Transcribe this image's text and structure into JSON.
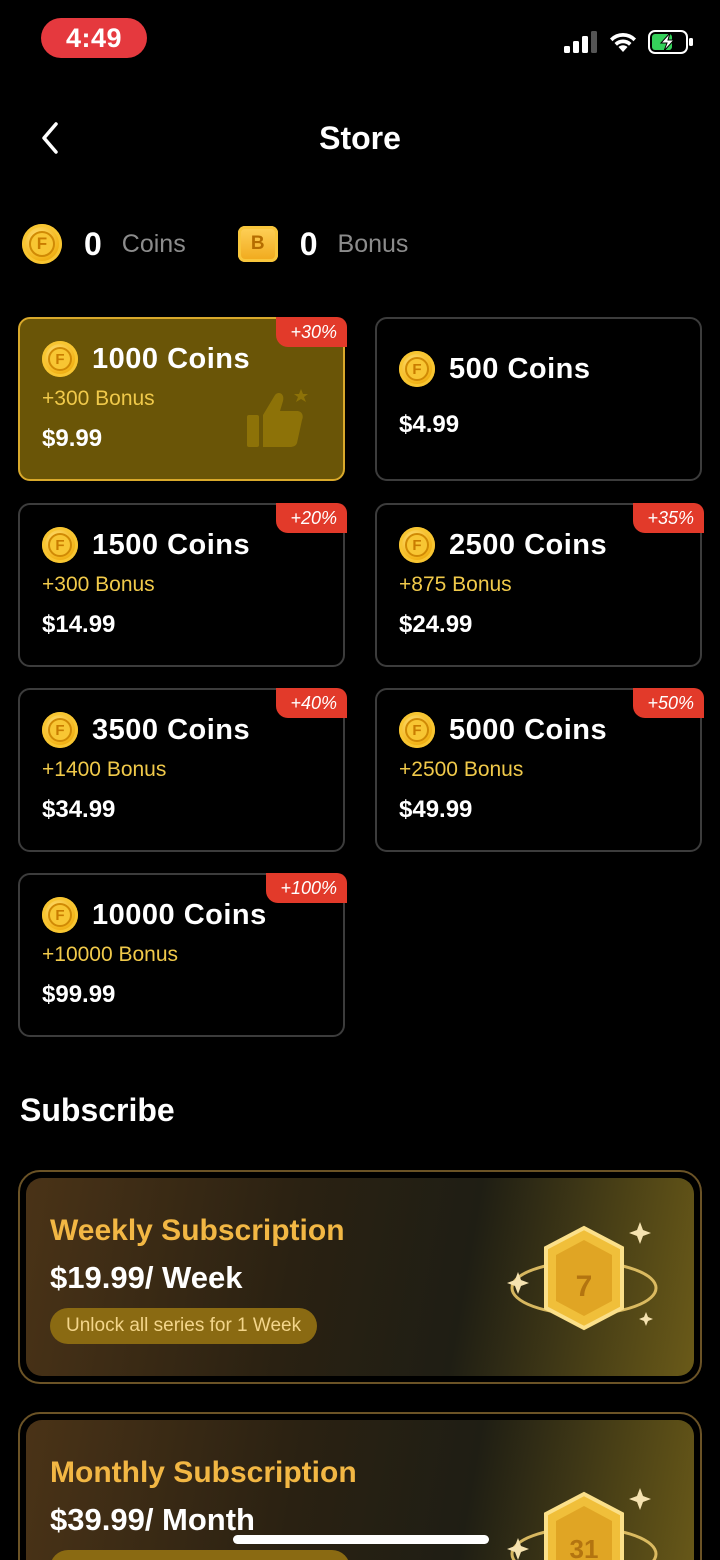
{
  "status_bar": {
    "time": "4:49"
  },
  "header": {
    "title": "Store"
  },
  "balance": {
    "coins_value": "0",
    "coins_label": "Coins",
    "bonus_value": "0",
    "bonus_label": "Bonus",
    "coin_icon_letter": "F",
    "bonus_icon_letter": "B"
  },
  "packages": [
    {
      "coins": "1000",
      "unit": "Coins",
      "bonus": "+300 Bonus",
      "price": "$9.99",
      "badge": "+30%",
      "selected": true
    },
    {
      "coins": "500",
      "unit": "Coins",
      "bonus": "",
      "price": "$4.99",
      "badge": ""
    },
    {
      "coins": "1500",
      "unit": "Coins",
      "bonus": "+300 Bonus",
      "price": "$14.99",
      "badge": "+20%"
    },
    {
      "coins": "2500",
      "unit": "Coins",
      "bonus": "+875 Bonus",
      "price": "$24.99",
      "badge": "+35%"
    },
    {
      "coins": "3500",
      "unit": "Coins",
      "bonus": "+1400 Bonus",
      "price": "$34.99",
      "badge": "+40%"
    },
    {
      "coins": "5000",
      "unit": "Coins",
      "bonus": "+2500 Bonus",
      "price": "$49.99",
      "badge": "+50%"
    },
    {
      "coins": "10000",
      "unit": "Coins",
      "bonus": "+10000 Bonus",
      "price": "$99.99",
      "badge": "+100%"
    }
  ],
  "subscribe": {
    "title": "Subscribe",
    "plans": [
      {
        "name": "Weekly Subscription",
        "price": "$19.99/ Week",
        "note": "Unlock all series for 1 Week",
        "emblem": "7"
      },
      {
        "name": "Monthly Subscription",
        "price": "$39.99/ Month",
        "note": "",
        "emblem": "31"
      }
    ]
  },
  "colors": {
    "accent_gold": "#f2b744",
    "badge_red": "#e23a2a",
    "time_pill": "#e5393e",
    "selected_card": "#6a5507"
  }
}
